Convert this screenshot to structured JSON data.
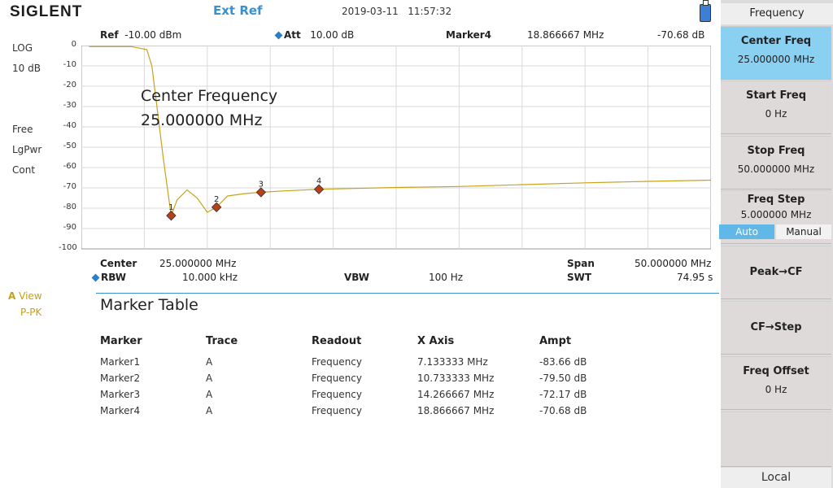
{
  "header": {
    "logo": "SIGLENT",
    "ext_ref": "Ext Ref",
    "date": "2019-03-11",
    "time": "11:57:32"
  },
  "left": {
    "scale_type": "LOG",
    "scale_div": "10 dB",
    "trigger": "Free",
    "detector": "LgPwr",
    "sweep_mode": "Cont",
    "trace_id": "A",
    "trace_mode": "View",
    "trace_det": "P-PK"
  },
  "plot_header": {
    "ref_label": "Ref",
    "ref_value": "-10.00 dBm",
    "att_label": "Att",
    "att_value": "10.00 dB",
    "marker_label": "Marker4",
    "marker_freq": "18.866667 MHz",
    "marker_ampt": "-70.68 dB"
  },
  "overlay": {
    "line1": "Center Frequency",
    "line2": "25.000000 MHz"
  },
  "plot": {
    "y_ticks": [
      "0",
      "-10",
      "-20",
      "-30",
      "-40",
      "-50",
      "-60",
      "-70",
      "-80",
      "-90",
      "-100"
    ],
    "trace_color": "#c9a21a",
    "marker_color": "#b5401a",
    "markers": [
      {
        "label": "1",
        "freq_mhz": 7.133333,
        "ampt_db": -83.66
      },
      {
        "label": "2",
        "freq_mhz": 10.733333,
        "ampt_db": -79.5
      },
      {
        "label": "3",
        "freq_mhz": 14.266667,
        "ampt_db": -72.17
      },
      {
        "label": "4",
        "freq_mhz": 18.866667,
        "ampt_db": -70.68
      }
    ]
  },
  "plot_footer": {
    "center_label": "Center",
    "center_value": "25.000000 MHz",
    "span_label": "Span",
    "span_value": "50.000000 MHz",
    "rbw_label": "RBW",
    "rbw_value": "10.000 kHz",
    "vbw_label": "VBW",
    "vbw_value": "100 Hz",
    "swt_label": "SWT",
    "swt_value": "74.95 s"
  },
  "marker_table": {
    "title": "Marker Table",
    "headers": [
      "Marker",
      "Trace",
      "Readout",
      "X Axis",
      "Ampt"
    ],
    "rows": [
      [
        "Marker1",
        "A",
        "Frequency",
        "7.133333 MHz",
        "-83.66 dB"
      ],
      [
        "Marker2",
        "A",
        "Frequency",
        "10.733333 MHz",
        "-79.50 dB"
      ],
      [
        "Marker3",
        "A",
        "Frequency",
        "14.266667 MHz",
        "-72.17 dB"
      ],
      [
        "Marker4",
        "A",
        "Frequency",
        "18.866667 MHz",
        "-70.68 dB"
      ]
    ]
  },
  "menu": {
    "title": "Frequency",
    "center_freq_label": "Center Freq",
    "center_freq_value": "25.000000 MHz",
    "start_freq_label": "Start Freq",
    "start_freq_value": "0 Hz",
    "stop_freq_label": "Stop Freq",
    "stop_freq_value": "50.000000 MHz",
    "freq_step_label": "Freq Step",
    "freq_step_value": "5.000000 MHz",
    "auto_label": "Auto",
    "manual_label": "Manual",
    "peak_cf_label": "Peak→CF",
    "cf_step_label": "CF→Step",
    "freq_offset_label": "Freq Offset",
    "freq_offset_value": "0 Hz",
    "local_label": "Local"
  }
}
